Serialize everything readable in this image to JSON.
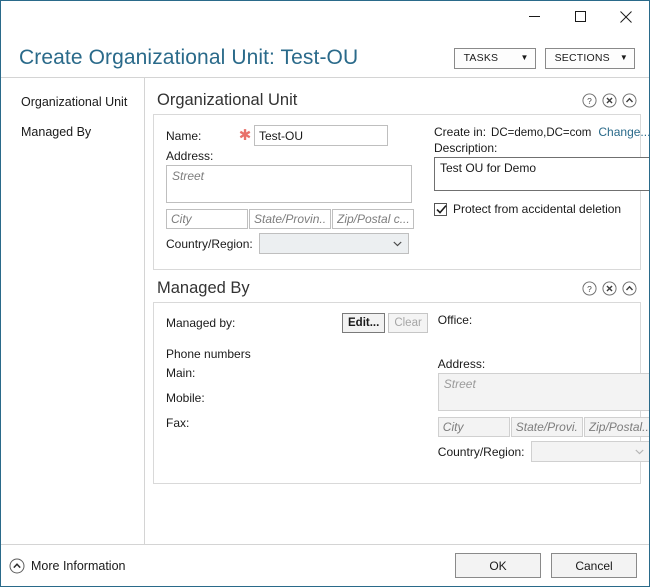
{
  "window": {
    "controls": {
      "minimize": "minimize-button",
      "maximize": "maximize-button",
      "close": "close-button"
    }
  },
  "header": {
    "title": "Create Organizational Unit: Test-OU",
    "tasks_label": "TASKS",
    "sections_label": "SECTIONS",
    "caret": "▼"
  },
  "sidebar": {
    "items": [
      {
        "label": "Organizational Unit"
      },
      {
        "label": "Managed By"
      }
    ]
  },
  "sections": {
    "ou": {
      "title": "Organizational Unit",
      "name_label": "Name:",
      "name_required": "✱",
      "name_value": "Test-OU",
      "address_label": "Address:",
      "street_placeholder": "Street",
      "city_placeholder": "City",
      "state_placeholder": "State/Provin...",
      "zip_placeholder": "Zip/Postal c...",
      "country_label": "Country/Region:",
      "country_value": "",
      "createin_label": "Create in:",
      "createin_value": "DC=demo,DC=com",
      "change_link": "Change...",
      "description_label": "Description:",
      "description_value": "Test OU for Demo",
      "protect_label": "Protect from accidental deletion",
      "protect_checked": true
    },
    "managed_by": {
      "title": "Managed By",
      "managed_by_label": "Managed by:",
      "edit_label": "Edit...",
      "clear_label": "Clear",
      "office_label": "Office:",
      "phone_numbers_label": "Phone numbers",
      "main_label": "Main:",
      "mobile_label": "Mobile:",
      "fax_label": "Fax:",
      "address_label": "Address:",
      "street_placeholder": "Street",
      "city_placeholder": "City",
      "state_placeholder": "State/Provi...",
      "zip_placeholder": "Zip/Postal...",
      "country_label": "Country/Region:",
      "country_value": ""
    }
  },
  "footer": {
    "more_information": "More Information",
    "ok_label": "OK",
    "cancel_label": "Cancel"
  },
  "colors": {
    "accent": "#2a6a8a",
    "required_star": "#e8726b",
    "link": "#2a6a8a",
    "panel_border": "#d9d9d9"
  }
}
